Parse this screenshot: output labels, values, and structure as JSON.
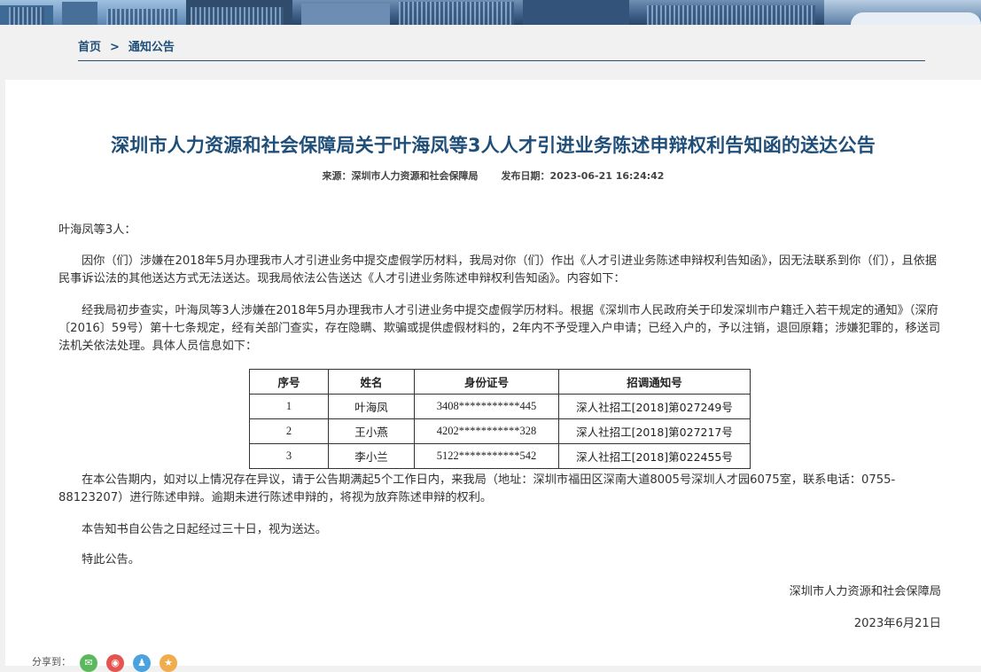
{
  "breadcrumb": {
    "home": "首页",
    "separator": ">",
    "current": "通知公告"
  },
  "article": {
    "title": "深圳市人力资源和社会保障局关于叶海凤等3人人才引进业务陈述申辩权利告知函的送达公告",
    "source_label": "来源：",
    "source": "深圳市人力资源和社会保障局",
    "date_label": "发布日期：",
    "date": "2023-06-21 16:24:42",
    "salutation": "叶海凤等3人：",
    "para1": "因你（们）涉嫌在2018年5月办理我市人才引进业务中提交虚假学历材料，我局对你（们）作出《人才引进业务陈述申辩权利告知函》，因无法联系到你（们），且依据民事诉讼法的其他送达方式无法送达。现我局依法公告送达《人才引进业务陈述申辩权利告知函》。内容如下：",
    "para2": "经我局初步查实，叶海凤等3人涉嫌在2018年5月办理我市人才引进业务中提交虚假学历材料。根据《深圳市人民政府关于印发深圳市户籍迁入若干规定的通知》（深府〔2016〕59号）第十七条规定，经有关部门查实，存在隐瞒、欺骗或提供虚假材料的，2年内不予受理入户申请；已经入户的，予以注销，退回原籍；涉嫌犯罪的，移送司法机关依法处理。具体人员信息如下：",
    "para3": "在本公告期内，如对以上情况存在异议，请于公告期满起5个工作日内，来我局（地址：深圳市福田区深南大道8005号深圳人才园6075室，联系电话：0755-88123207）进行陈述申辩。逾期未进行陈述申辩的，将视为放弃陈述申辩的权利。",
    "para4": "本告知书自公告之日起经过三十日，视为送达。",
    "para5": "特此公告。",
    "signature": "深圳市人力资源和社会保障局",
    "sign_date": "2023年6月21日"
  },
  "table": {
    "headers": [
      "序号",
      "姓名",
      "身份证号",
      "招调通知号"
    ],
    "rows": [
      [
        "1",
        "叶海凤",
        "3408***********445",
        "深人社招工[2018]第027249号"
      ],
      [
        "2",
        "王小燕",
        "4202***********328",
        "深人社招工[2018]第027217号"
      ],
      [
        "3",
        "李小兰",
        "5122***********542",
        "深人社招工[2018]第022455号"
      ]
    ]
  },
  "share": {
    "label": "分享到：",
    "icons": [
      "wechat-icon",
      "weibo-icon",
      "qq-icon",
      "qzone-icon"
    ],
    "colors": [
      "#5cb85c",
      "#e6544f",
      "#4aa3df",
      "#f0ad4e"
    ]
  }
}
